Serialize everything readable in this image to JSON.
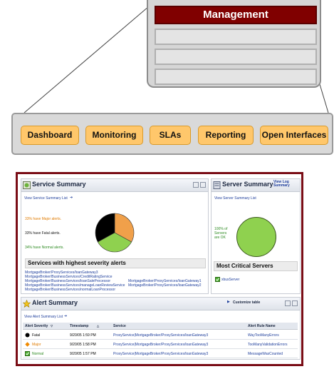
{
  "management": {
    "title": "Management",
    "colors": {
      "title_bg": "#800000",
      "panel_bg": "#d6d6d6"
    }
  },
  "nav": {
    "items": [
      "Dashboard",
      "Monitoring",
      "SLAs",
      "Reporting",
      "Open Interfaces"
    ],
    "colors": {
      "button": "#ffc76b",
      "bar": "#d9d9d9"
    }
  },
  "console": {
    "border_color": "#7a0d16",
    "service_summary": {
      "title": "Service Summary",
      "view_link": "View Service Summary List",
      "arrow": "➔",
      "legend": {
        "major": "33% have Major alerts.",
        "fatal": "33% have Fatal alerts.",
        "normal": "34% have Normal alerts."
      },
      "pie": [
        {
          "label": "Major",
          "percent": 33,
          "color": "#f0a04a"
        },
        {
          "label": "Normal",
          "percent": 34,
          "color": "#8fd14f"
        },
        {
          "label": "Fatal",
          "percent": 33,
          "color": "#000000"
        }
      ],
      "highest_heading": "Services with highest severity alerts",
      "services_left": [
        "MortgageBroker/ProxyServices/loanGateway3",
        "MortgageBroker/BusinessServices/CreditRatingService",
        "MortgageBroker/BusinessServices/loanSaleProcessor",
        "MortgageBroker/BusinessServices/manageLoanReviewService",
        "MortgageBroker/BusinessServices/normalLoanProcessor"
      ],
      "services_right": [
        "MortgageBroker/ProxyServices/loanGateway1",
        "MortgageBroker/ProxyServices/loanGateway2"
      ]
    },
    "server_summary": {
      "title": "Server Summary",
      "view_log": "View Log Summary",
      "view_link": "View Server Summary List",
      "ok_text": [
        "100% of",
        "Servers",
        "are OK"
      ],
      "pie_color": "#8fd14f",
      "critical_heading": "Most Critical Servers",
      "critical_server": "xbusServer"
    },
    "alert_summary": {
      "title": "Alert Summary",
      "customize": "Customize table",
      "view_link": "View Alert Summary List",
      "columns": [
        "Alert Severity",
        "Timestamp",
        "Service",
        "Alert Rule Name"
      ],
      "rows": [
        {
          "severity": "Fatal",
          "severity_color": "#000000",
          "timestamp": "9/20/05 1:59 PM",
          "service": "ProxyService|MortgageBroker/ProxyServices/loanGateway3",
          "rule": "WayTooManyErrors"
        },
        {
          "severity": "Major",
          "severity_color": "#e07b00",
          "timestamp": "9/20/05 1:58 PM",
          "service": "ProxyService|MortgageBroker/ProxyServices/loanGateway3",
          "rule": "TooManyValidationErrors"
        },
        {
          "severity": "Normal",
          "severity_color": "#2e8b22",
          "timestamp": "9/20/05 1:57 PM",
          "service": "ProxyService|MortgageBroker/ProxyServices/loanGateway3",
          "rule": "MessageWasCounted"
        }
      ]
    }
  }
}
